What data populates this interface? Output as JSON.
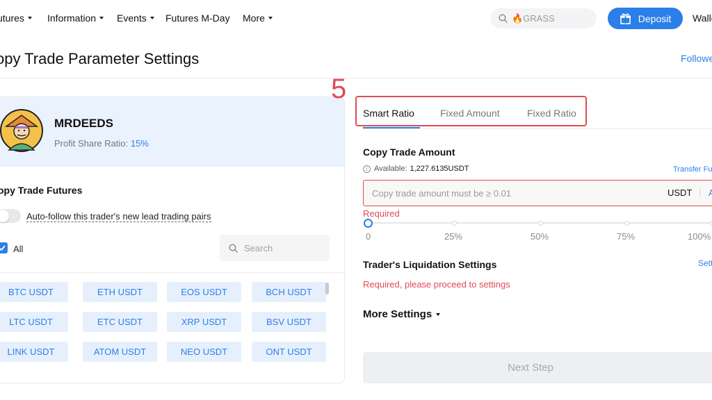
{
  "nav": {
    "items": [
      {
        "label": "utures",
        "caret": true
      },
      {
        "label": "Information",
        "caret": true
      },
      {
        "label": "Events",
        "caret": true
      },
      {
        "label": "Futures M-Day",
        "caret": false
      },
      {
        "label": "More",
        "caret": true
      }
    ],
    "search_placeholder": "🔥GRASS",
    "deposit_label": "Deposit",
    "wallet_label": "Walle"
  },
  "page": {
    "title": "opy Trade Parameter Settings",
    "followed_link": "Followe"
  },
  "trader": {
    "name": "MRDEEDS",
    "share_label": "Profit Share Ratio:",
    "share_value": "15%"
  },
  "futures": {
    "title": "opy Trade Futures",
    "auto_follow_label": "Auto-follow this trader's new lead trading pairs",
    "auto_follow_on": false,
    "all_label": "All",
    "all_checked": true,
    "search_placeholder": "Search",
    "pairs": [
      [
        "BTC USDT",
        "ETH USDT",
        "EOS USDT",
        "BCH USDT"
      ],
      [
        "LTC USDT",
        "ETC USDT",
        "XRP USDT",
        "BSV USDT"
      ],
      [
        "LINK USDT",
        "ATOM USDT",
        "NEO USDT",
        "ONT USDT"
      ]
    ]
  },
  "annotation": {
    "step_number": "5"
  },
  "tabs": [
    {
      "label": "Smart Ratio",
      "active": true
    },
    {
      "label": "Fixed Amount",
      "active": false
    },
    {
      "label": "Fixed Ratio",
      "active": false
    }
  ],
  "copy_amount": {
    "title": "Copy Trade Amount",
    "available_label": "Available:",
    "available_value": "1,227.6135USDT",
    "transfer_link": "Transfer Fu",
    "input_placeholder": "Copy trade amount must be ≥ 0.01",
    "unit": "USDT",
    "unit_action": "A",
    "required_text": "Required",
    "slider_value": 0,
    "slider_labels": [
      "0",
      "25%",
      "50%",
      "75%",
      "100%"
    ]
  },
  "liquidation": {
    "title": "Trader's Liquidation Settings",
    "settings_link": "Sett",
    "required_text": "Required, please proceed to settings"
  },
  "more_settings_label": "More Settings",
  "next_button_label": "Next Step",
  "colors": {
    "accent": "#2b7fe8",
    "error": "#e04a55",
    "trader_card_bg": "#eaf2fe",
    "pair_bg": "#e6f0fd"
  }
}
